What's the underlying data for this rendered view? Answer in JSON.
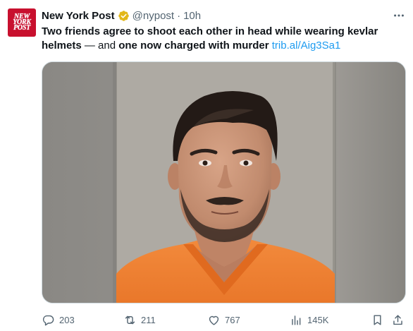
{
  "tweet": {
    "author": {
      "name": "New York Post",
      "handle": "@nypost",
      "separator": "·",
      "time": "10h",
      "avatar_lines": [
        "NEW",
        "YORK",
        "POST"
      ],
      "verified_icon": "gold-verified-badge-icon"
    },
    "text": {
      "part1": "Two friends agree to shoot each other in head while wearing kevlar helmets",
      "part2": " — and ",
      "part3": "one now charged with murder",
      "part4": " ",
      "link": "trib.al/Aig3Sa1"
    },
    "media": {
      "icon": "mugshot-photo"
    },
    "actions": {
      "replies": "203",
      "reposts": "211",
      "likes": "767",
      "views": "145K"
    }
  },
  "colors": {
    "brand_red": "#c8102e",
    "link_blue": "#1d9bf0",
    "secondary_text": "#536471",
    "verified_gold": "#e2b719"
  }
}
